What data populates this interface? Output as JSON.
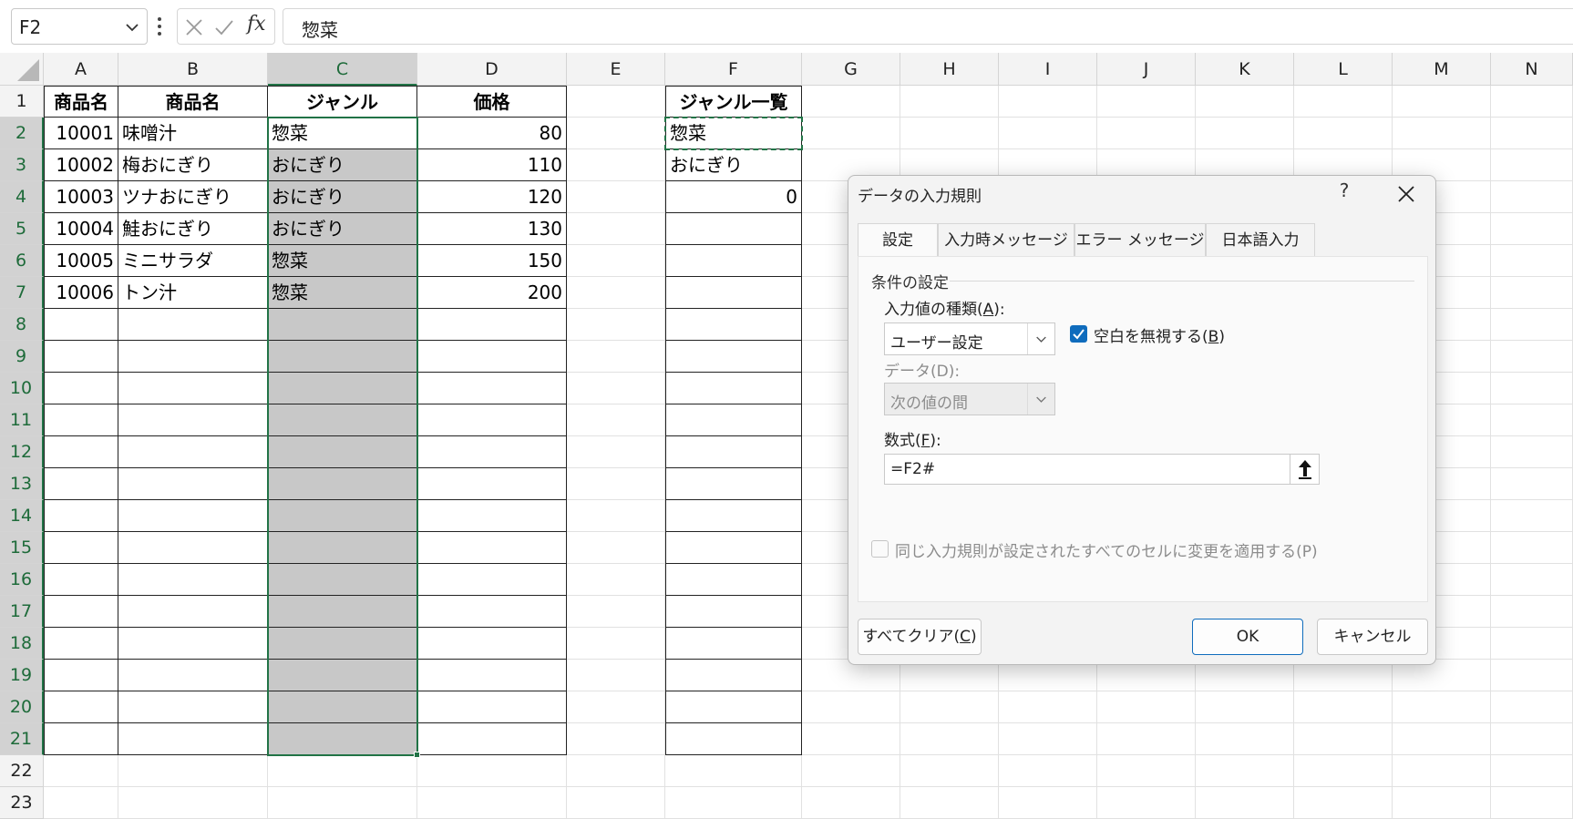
{
  "formula_bar": {
    "name_box": "F2",
    "formula": "惣菜"
  },
  "columns": [
    "A",
    "B",
    "C",
    "D",
    "E",
    "F",
    "G",
    "H",
    "I",
    "J",
    "K",
    "L",
    "M",
    "N"
  ],
  "rows": [
    "1",
    "2",
    "3",
    "4",
    "5",
    "6",
    "7",
    "8",
    "9",
    "10",
    "11",
    "12",
    "13",
    "14",
    "15",
    "16",
    "17",
    "18",
    "19",
    "20",
    "21",
    "22",
    "23"
  ],
  "table": {
    "headers": [
      "商品名",
      "商品名",
      "ジャンル",
      "価格"
    ],
    "rows": [
      [
        "10001",
        "味噌汁",
        "惣菜",
        "80"
      ],
      [
        "10002",
        "梅おにぎり",
        "おにぎり",
        "110"
      ],
      [
        "10003",
        "ツナおにぎり",
        "おにぎり",
        "120"
      ],
      [
        "10004",
        "鮭おにぎり",
        "おにぎり",
        "130"
      ],
      [
        "10005",
        "ミニサラダ",
        "惣菜",
        "150"
      ],
      [
        "10006",
        "トン汁",
        "惣菜",
        "200"
      ]
    ]
  },
  "genre_list": {
    "header": "ジャンル一覧",
    "items": [
      "惣菜",
      "おにぎり",
      "0"
    ]
  },
  "dialog": {
    "title": "データの入力規則",
    "help": "?",
    "tabs": [
      "設定",
      "入力時メッセージ",
      "エラー メッセージ",
      "日本語入力"
    ],
    "group_title": "条件の設定",
    "allow_label_pre": "入力値の種類(",
    "allow_label_key": "A",
    "allow_label_post": "):",
    "allow_value": "ユーザー設定",
    "ignore_blank_pre": "空白を無視する(",
    "ignore_blank_key": "B",
    "ignore_blank_post": ")",
    "data_label": "データ(D):",
    "data_value": "次の値の間",
    "formula_label_pre": "数式(",
    "formula_label_key": "F",
    "formula_label_post": "):",
    "formula_value": "=F2#",
    "apply_all_label": "同じ入力規則が設定されたすべてのセルに変更を適用する(P)",
    "clear_all_pre": "すべてクリア(",
    "clear_all_key": "C",
    "clear_all_post": ")",
    "ok": "OK",
    "cancel": "キャンセル"
  },
  "colors": {
    "selection": "#217346",
    "checkbox": "#0f6cbd",
    "range_fill": "#c8c8c8"
  }
}
